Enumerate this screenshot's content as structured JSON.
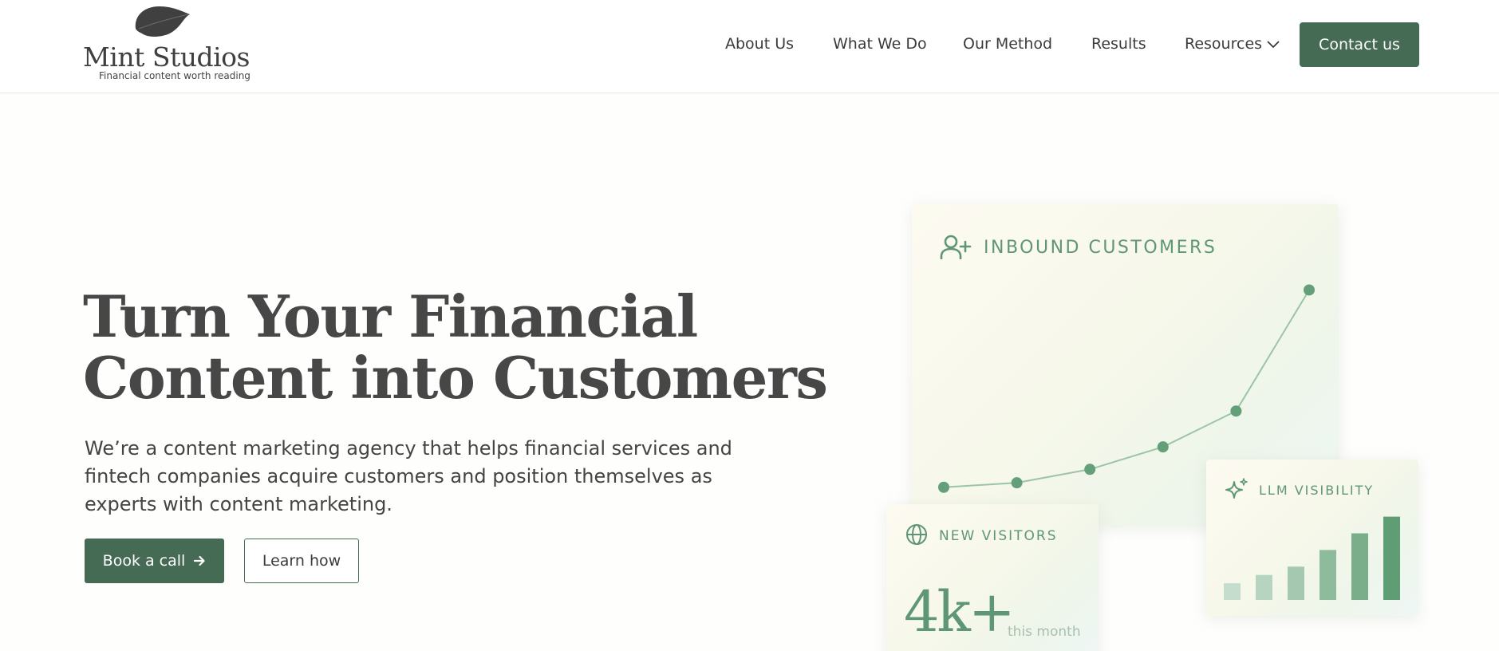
{
  "header": {
    "logo": {
      "title": "Mint Studios",
      "tagline": "Financial content worth reading",
      "icon": "leaf-icon"
    },
    "nav": [
      {
        "label": "About Us"
      },
      {
        "label": "What We Do"
      },
      {
        "label": "Our Method"
      },
      {
        "label": "Results"
      },
      {
        "label": "Resources",
        "has_dropdown": true,
        "icon": "chevron-down-icon"
      }
    ],
    "cta_label": "Contact us"
  },
  "hero": {
    "title_line1": "Turn Your Financial",
    "title_line2": "Content into Customers",
    "subtitle": "We’re a content marketing agency that helps financial services and fintech companies acquire customers and position themselves as experts with content marketing.",
    "primary_button": {
      "label": "Book a call",
      "icon": "arrow-right-icon"
    },
    "secondary_button": {
      "label": "Learn how"
    }
  },
  "cards": {
    "inbound": {
      "label": "INBOUND CUSTOMERS",
      "icon": "user-plus-icon"
    },
    "visitors": {
      "label": "NEW VISITORS",
      "icon": "globe-icon",
      "value": "4k+",
      "unit": "this month"
    },
    "llm": {
      "label": "LLM VISIBILITY",
      "icon": "sparkles-icon"
    }
  },
  "colors": {
    "brand": "#456b55",
    "accent": "#5f9675",
    "text": "#444444"
  },
  "chart_data": [
    {
      "type": "line",
      "title": "INBOUND CUSTOMERS",
      "x": [
        1,
        2,
        3,
        4,
        5,
        6
      ],
      "series": [
        {
          "values": [
            2,
            3,
            6,
            11,
            19,
            46
          ]
        }
      ],
      "ylim": [
        0,
        50
      ],
      "grid": false,
      "axes_visible": false,
      "color": "#7fb08d"
    },
    {
      "type": "bar",
      "title": "LLM VISIBILITY",
      "categories": [
        "1",
        "2",
        "3",
        "4",
        "5",
        "6"
      ],
      "values": [
        18,
        27,
        36,
        54,
        72,
        90
      ],
      "ylim": [
        0,
        100
      ],
      "grid": false,
      "axes_visible": false,
      "colors": [
        "#c5ddcd",
        "#b7d4c1",
        "#a4c8b0",
        "#8fbb9d",
        "#7aae8b",
        "#5f9d74"
      ]
    }
  ]
}
